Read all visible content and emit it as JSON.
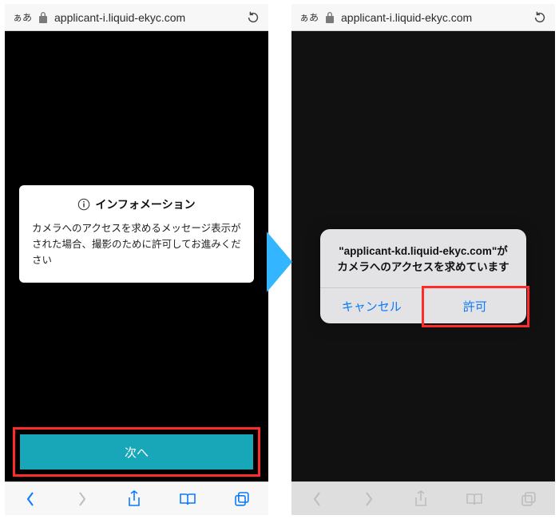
{
  "url_bar": {
    "aa_label": "ぁあ",
    "url_left": "applicant-i.liquid-ekyc.com",
    "url_right": "applicant-i.liquid-ekyc.com"
  },
  "left_screen": {
    "info_title": "インフォメーション",
    "info_body": "カメラへのアクセスを求めるメッセージ表示がされた場合、撮影のために許可してお進みください",
    "next_button": "次へ"
  },
  "right_screen": {
    "alert_message": "\"applicant-kd.liquid-ekyc.com\"がカメラへのアクセスを求めています",
    "cancel_button": "キャンセル",
    "allow_button": "許可"
  },
  "colors": {
    "accent_button": "#17a7b8",
    "ios_blue": "#0a7aff",
    "highlight_red": "#ff2a2a",
    "arrow_blue": "#33b6ff"
  }
}
